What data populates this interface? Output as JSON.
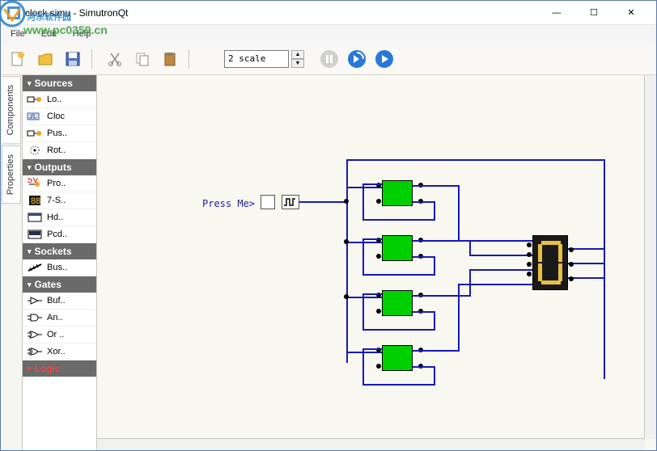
{
  "window": {
    "title": "clock.simu - SimutronQt",
    "minimize": "—",
    "maximize": "☐",
    "close": "✕"
  },
  "menu": {
    "file": "File",
    "edit": "Edit",
    "help": "Help"
  },
  "toolbar": {
    "new": "new-file",
    "open": "open-file",
    "save": "save-file",
    "cut": "cut",
    "copy": "copy",
    "paste": "paste",
    "scale_value": "2 scale",
    "pause": "pause",
    "step": "step",
    "play": "play"
  },
  "sidetabs": {
    "components": "Components",
    "properties": "Properties"
  },
  "tree": {
    "sources": {
      "label": "Sources",
      "items": [
        "Lo..",
        "Cloc",
        "Pus..",
        "Rot.."
      ]
    },
    "outputs": {
      "label": "Outputs",
      "items": [
        "Pro..",
        "7-S..",
        "Hd..",
        "Pcd.."
      ]
    },
    "sockets": {
      "label": "Sockets",
      "items": [
        "Bus.."
      ]
    },
    "gates": {
      "label": "Gates",
      "items": [
        "Buf..",
        "An..",
        "Or ..",
        "Xor.."
      ]
    },
    "logic": {
      "label": "Logic"
    }
  },
  "circuit": {
    "label": "Press Me>",
    "display_value": "0"
  },
  "watermark": {
    "main": "河东软件园",
    "url": "www.pc0359.cn"
  }
}
